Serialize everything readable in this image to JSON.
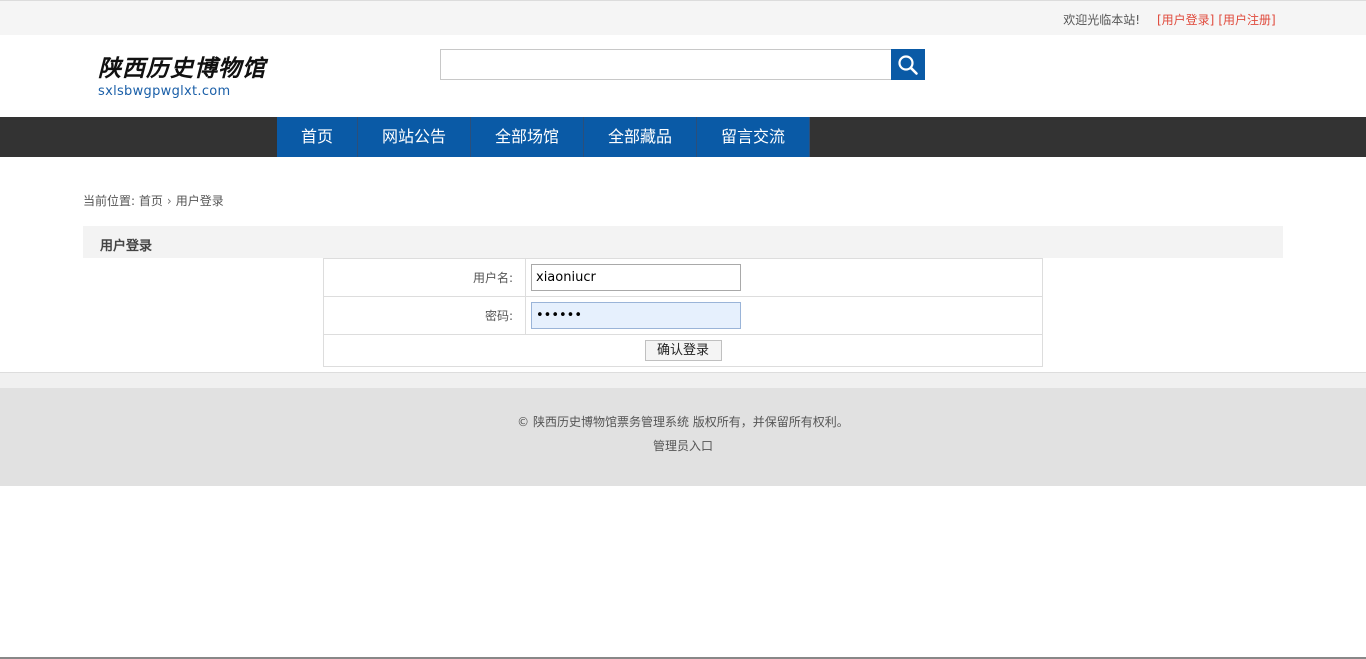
{
  "topbar": {
    "welcome": "欢迎光临本站!",
    "login_link": "[用户登录]",
    "register_link": "[用户注册]"
  },
  "logo": {
    "name": "陕西历史博物馆",
    "domain": "sxlsbwgpwglxt.com"
  },
  "search": {
    "value": "",
    "icon": "search-icon"
  },
  "nav": {
    "items": [
      "首页",
      "网站公告",
      "全部场馆",
      "全部藏品",
      "留言交流"
    ]
  },
  "breadcrumb": {
    "prefix": "当前位置:",
    "home": "首页",
    "current": "用户登录"
  },
  "panel": {
    "title": "用户登录"
  },
  "form": {
    "username_label": "用户名:",
    "username_value": "xiaoniucr",
    "password_label": "密码:",
    "password_value": "••••••",
    "submit_label": "确认登录"
  },
  "footer": {
    "copyright": "© 陕西历史博物馆票务管理系统 版权所有，并保留所有权利。",
    "admin_link": "管理员入口"
  },
  "colors": {
    "brand_blue": "#0a5aa6",
    "nav_bg": "#333333",
    "link_red": "#e04a3c"
  }
}
